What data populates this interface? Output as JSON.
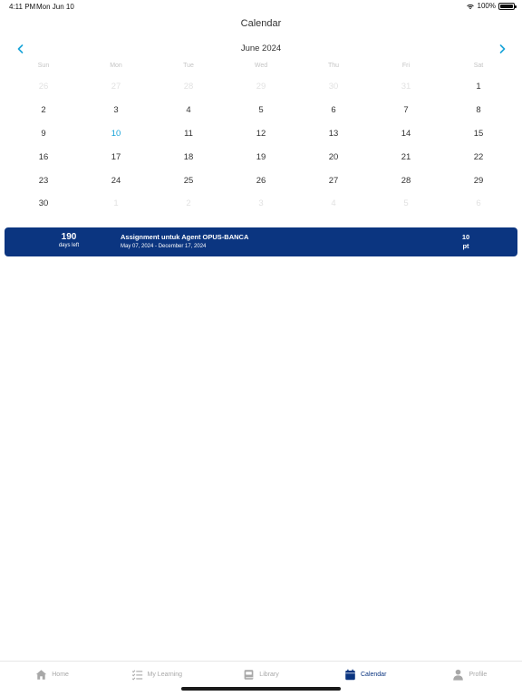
{
  "status_bar": {
    "time": "4:11 PM",
    "date": "Mon Jun 10",
    "battery": "100%"
  },
  "header": {
    "title": "Calendar"
  },
  "calendar": {
    "month_label": "June 2024",
    "weekdays": [
      "Sun",
      "Mon",
      "Tue",
      "Wed",
      "Thu",
      "Fri",
      "Sat"
    ],
    "weeks": [
      [
        {
          "d": "26",
          "m": true
        },
        {
          "d": "27",
          "m": true
        },
        {
          "d": "28",
          "m": true
        },
        {
          "d": "29",
          "m": true
        },
        {
          "d": "30",
          "m": true
        },
        {
          "d": "31",
          "m": true
        },
        {
          "d": "1"
        }
      ],
      [
        {
          "d": "2"
        },
        {
          "d": "3"
        },
        {
          "d": "4"
        },
        {
          "d": "5"
        },
        {
          "d": "6"
        },
        {
          "d": "7"
        },
        {
          "d": "8"
        }
      ],
      [
        {
          "d": "9"
        },
        {
          "d": "10",
          "today": true
        },
        {
          "d": "11"
        },
        {
          "d": "12"
        },
        {
          "d": "13"
        },
        {
          "d": "14"
        },
        {
          "d": "15"
        }
      ],
      [
        {
          "d": "16"
        },
        {
          "d": "17"
        },
        {
          "d": "18"
        },
        {
          "d": "19"
        },
        {
          "d": "20"
        },
        {
          "d": "21"
        },
        {
          "d": "22"
        }
      ],
      [
        {
          "d": "23"
        },
        {
          "d": "24"
        },
        {
          "d": "25"
        },
        {
          "d": "26"
        },
        {
          "d": "27"
        },
        {
          "d": "28"
        },
        {
          "d": "29"
        }
      ],
      [
        {
          "d": "30"
        },
        {
          "d": "1",
          "m": true
        },
        {
          "d": "2",
          "m": true
        },
        {
          "d": "3",
          "m": true
        },
        {
          "d": "4",
          "m": true
        },
        {
          "d": "5",
          "m": true
        },
        {
          "d": "6",
          "m": true
        }
      ]
    ],
    "today_color": "#1aa4d9",
    "muted_color": "#e2e2e2"
  },
  "event": {
    "days_left_number": "190",
    "days_left_label": "days left",
    "title": "Assignment untuk Agent OPUS-BANCA",
    "dates": "May 07, 2024 - December 17, 2024",
    "points_value": "10",
    "points_unit": "pt",
    "background": "#0b3580"
  },
  "tab_bar": {
    "active_color": "#0b3580",
    "inactive_color": "#a8a8a8",
    "tabs": [
      {
        "label": "Home",
        "icon": "home-icon"
      },
      {
        "label": "My Learning",
        "icon": "checklist-icon"
      },
      {
        "label": "Library",
        "icon": "book-icon"
      },
      {
        "label": "Calendar",
        "icon": "calendar-icon",
        "active": true
      },
      {
        "label": "Profile",
        "icon": "person-icon"
      }
    ]
  }
}
